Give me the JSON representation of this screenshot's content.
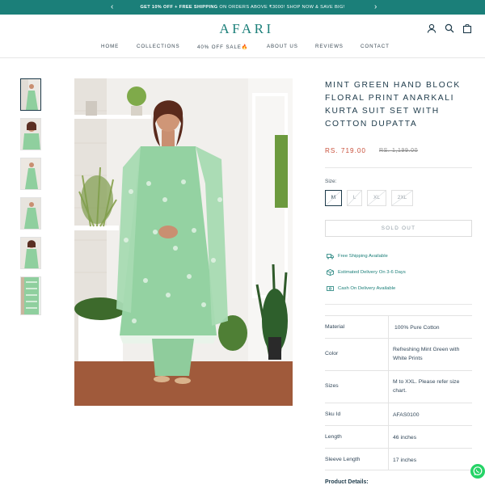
{
  "announcement": {
    "bold": "GET 10% OFF + FREE SHIPPING",
    "rest": " ON ORDERS ABOVE ₹3000! SHOP NOW & SAVE BIG!",
    "prev_icon": "chevron-left-icon",
    "next_icon": "chevron-right-icon"
  },
  "header": {
    "logo": "AFARI",
    "icons": [
      "account-icon",
      "search-icon",
      "bag-icon"
    ]
  },
  "nav": {
    "items": [
      "HOME",
      "COLLECTIONS",
      "40% OFF SALE🔥",
      "ABOUT US",
      "REVIEWS",
      "CONTACT"
    ]
  },
  "gallery": {
    "thumbnail_count": 6,
    "active_index": 0
  },
  "product": {
    "title": "MINT GREEN HAND BLOCK FLORAL PRINT ANARKALI KURTA SUIT SET WITH COTTON DUPATTA",
    "price": "RS. 719.00",
    "compare_price": "RS. 1,199.00",
    "size_label": "Size:",
    "sizes": [
      "M",
      "L",
      "XL",
      "2XL"
    ],
    "selected_size": "M",
    "button_label": "SOLD OUT"
  },
  "features": [
    {
      "icon": "truck-icon",
      "text": "Free Shipping Available"
    },
    {
      "icon": "box-icon",
      "text": "Estimated Delivery On 3-6 Days"
    },
    {
      "icon": "cash-icon",
      "text": "Cash On Delivery Available"
    }
  ],
  "specs": [
    {
      "label": "Material",
      "value": "100% Pure Cotton"
    },
    {
      "label": "Color",
      "value": "Refreshing Mint Green with White Prints"
    },
    {
      "label": "Sizes",
      "value": "M to XXL. Please refer size chart."
    },
    {
      "label": "Sku Id",
      "value": "AFAS0100"
    },
    {
      "label": "Length",
      "value": "46 inches"
    },
    {
      "label": "Sleeve Length",
      "value": "17 inches"
    }
  ],
  "details_heading": "Product Details:",
  "colors": {
    "brand": "#1b7f79",
    "price": "#c9503b",
    "text": "#1d3a4a",
    "garment": "#8fcf9e",
    "whatsapp": "#25d366"
  }
}
